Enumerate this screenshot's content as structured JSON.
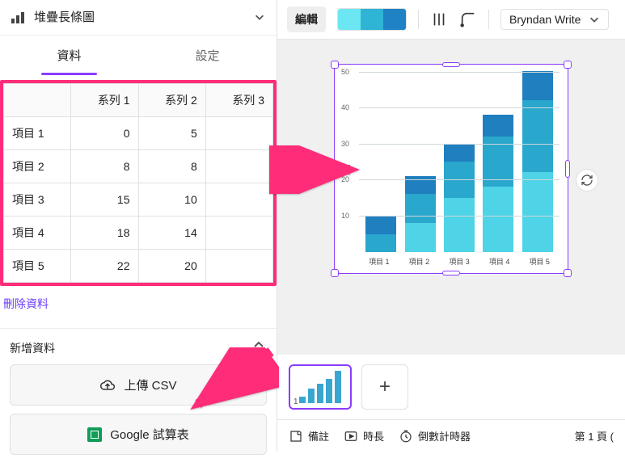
{
  "chart_type_label": "堆疊長條圖",
  "tabs": {
    "data": "資料",
    "settings": "設定"
  },
  "table": {
    "headers": [
      "",
      "系列 1",
      "系列 2",
      "系列 3"
    ],
    "rows": [
      {
        "label": "項目 1",
        "v1": "0",
        "v2": "5",
        "v3": ""
      },
      {
        "label": "項目 2",
        "v1": "8",
        "v2": "8",
        "v3": ""
      },
      {
        "label": "項目 3",
        "v1": "15",
        "v2": "10",
        "v3": ""
      },
      {
        "label": "項目 4",
        "v1": "18",
        "v2": "14",
        "v3": ""
      },
      {
        "label": "項目 5",
        "v1": "22",
        "v2": "20",
        "v3": ""
      }
    ]
  },
  "clear_data": "刪除資料",
  "add_data_title": "新增資料",
  "upload_csv": "上傳 CSV",
  "google_sheets": "Google 試算表",
  "toolbar": {
    "edit": "編輯",
    "swatches": [
      "#6be6f2",
      "#2fb4d6",
      "#1e82c4"
    ],
    "font": "Bryndan Write"
  },
  "chart_data": {
    "type": "bar",
    "stacked": true,
    "categories": [
      "項目 1",
      "項目 2",
      "項目 3",
      "項目 4",
      "項目 5"
    ],
    "series": [
      {
        "name": "系列 1",
        "values": [
          0,
          8,
          15,
          18,
          22
        ]
      },
      {
        "name": "系列 2",
        "values": [
          5,
          8,
          10,
          14,
          20
        ]
      },
      {
        "name": "系列 3",
        "values": [
          5,
          5,
          5,
          6,
          8
        ]
      }
    ],
    "ylim": [
      0,
      50
    ],
    "yticks": [
      10,
      20,
      30,
      40,
      50
    ],
    "colors": [
      "#4fd3e6",
      "#2aa7cc",
      "#1f7fbf"
    ]
  },
  "thumb_number": "1",
  "bottombar": {
    "notes": "備註",
    "duration": "時長",
    "timer": "倒數計時器",
    "page": "第 1 頁 ("
  }
}
